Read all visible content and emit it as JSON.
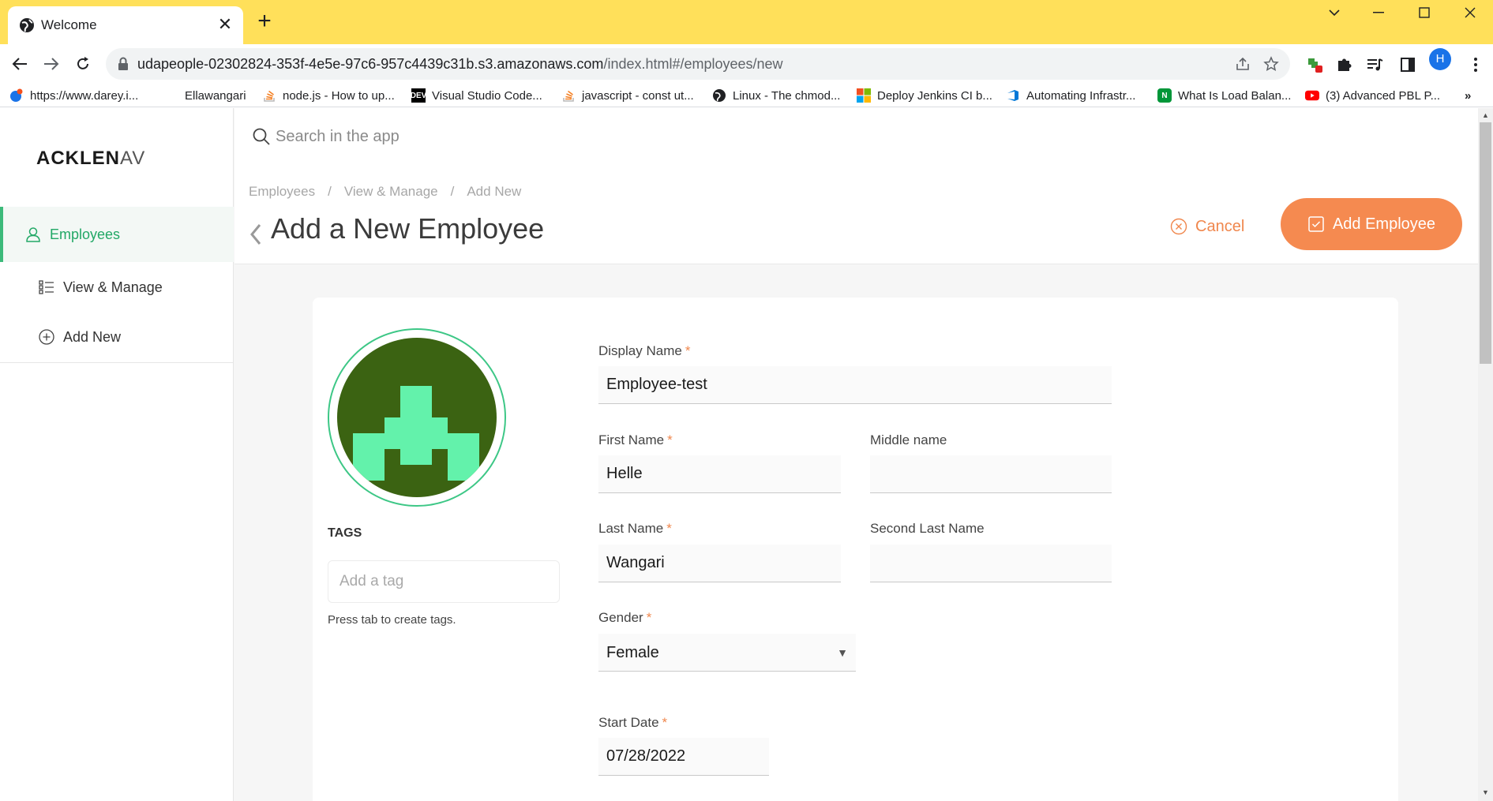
{
  "browser": {
    "tab_title": "Welcome",
    "url_host": "udapeople-02302824-353f-4e5e-97c6-957c4439c31b.s3.amazonaws.com",
    "url_path": "/index.html#/employees/new",
    "profile_initial": "H",
    "bookmarks": [
      {
        "label": "https://www.darey.i...",
        "icon": "darey-icon"
      },
      {
        "label": "Ellawangari",
        "icon": "none"
      },
      {
        "label": "node.js - How to up...",
        "icon": "stackoverflow-icon"
      },
      {
        "label": "Visual Studio Code...",
        "icon": "dev-icon"
      },
      {
        "label": "javascript - const ut...",
        "icon": "stackoverflow-icon"
      },
      {
        "label": "Linux - The chmod...",
        "icon": "globe-icon"
      },
      {
        "label": "Deploy Jenkins CI b...",
        "icon": "microsoft-icon"
      },
      {
        "label": "Automating Infrastr...",
        "icon": "azure-devops-icon"
      },
      {
        "label": "What Is Load Balan...",
        "icon": "nginx-icon"
      },
      {
        "label": "(3) Advanced PBL P...",
        "icon": "youtube-icon"
      }
    ],
    "bookmarks_overflow": "»"
  },
  "app": {
    "logo_bold": "ACKLEN",
    "logo_thin": "AV",
    "search_placeholder": "Search in the app",
    "sidebar": [
      {
        "label": "Employees",
        "icon": "person-icon",
        "active": true
      },
      {
        "label": "View & Manage",
        "icon": "list-icon",
        "active": false
      },
      {
        "label": "Add New",
        "icon": "plus-circle-icon",
        "active": false
      }
    ],
    "breadcrumb": [
      "Employees",
      "View & Manage",
      "Add New"
    ],
    "breadcrumb_sep": "/",
    "page_title": "Add a New Employee",
    "cancel_label": "Cancel",
    "add_label": "Add Employee",
    "accent_color": "#f58a50",
    "active_color": "#22a866"
  },
  "form": {
    "tags_label": "TAGS",
    "tag_placeholder": "Add a tag",
    "tag_hint": "Press tab to create tags.",
    "required_mark": "*",
    "display_name_label": "Display Name",
    "display_name_value": "Employee-test",
    "first_name_label": "First Name",
    "first_name_value": "Helle",
    "middle_name_label": "Middle name",
    "middle_name_value": "",
    "last_name_label": "Last Name",
    "last_name_value": "Wangari",
    "second_last_name_label": "Second Last Name",
    "second_last_name_value": "",
    "gender_label": "Gender",
    "gender_value": "Female",
    "start_date_label": "Start Date",
    "start_date_value": "07/28/2022"
  }
}
